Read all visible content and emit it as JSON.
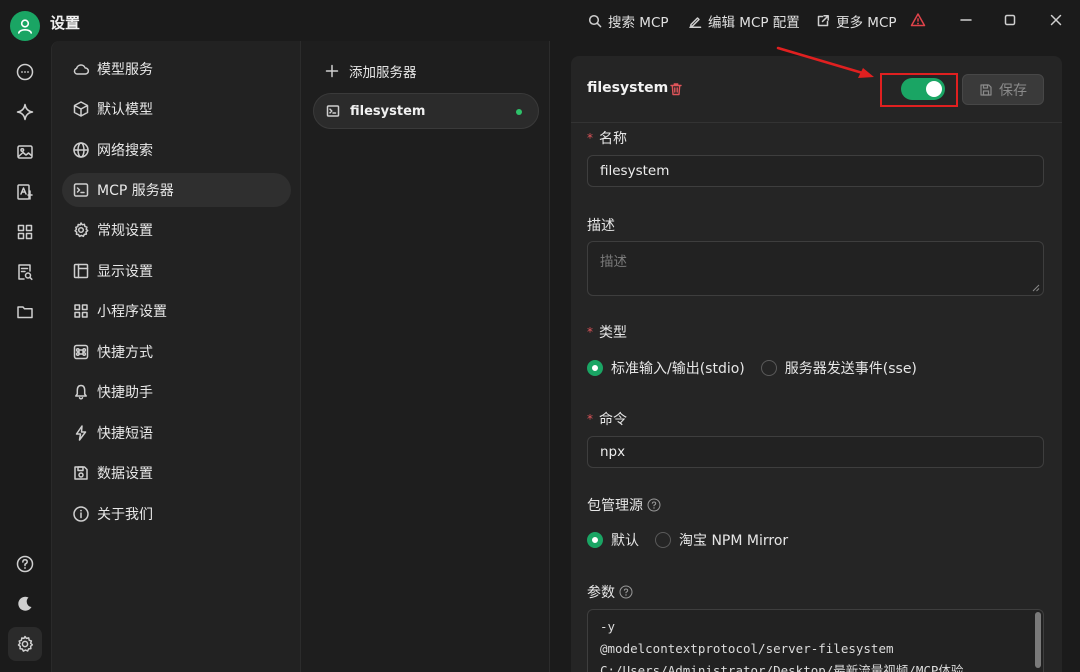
{
  "titlebar": {
    "title": "设置",
    "actions": [
      {
        "label": "搜索 MCP",
        "icon": "search-icon"
      },
      {
        "label": "编辑 MCP 配置",
        "icon": "edit-icon"
      },
      {
        "label": "更多 MCP",
        "icon": "external-link-icon"
      }
    ],
    "warning_icon": "warning-icon",
    "window_controls": [
      "minimize-icon",
      "maximize-icon",
      "close-icon"
    ]
  },
  "rail": {
    "icons": [
      "chat-icon",
      "sparkle-icon",
      "image-icon",
      "translate-icon",
      "apps-icon",
      "doc-search-icon",
      "folder-icon"
    ],
    "bottom_icons": [
      "help-icon",
      "moon-icon",
      "settings-icon"
    ]
  },
  "settings_nav": {
    "items": [
      {
        "label": "模型服务",
        "icon": "cloud-icon"
      },
      {
        "label": "默认模型",
        "icon": "cube-icon"
      },
      {
        "label": "网络搜索",
        "icon": "globe-icon"
      },
      {
        "label": "MCP 服务器",
        "icon": "terminal-icon",
        "active": true
      },
      {
        "label": "常规设置",
        "icon": "gear-icon"
      },
      {
        "label": "显示设置",
        "icon": "layout-icon"
      },
      {
        "label": "小程序设置",
        "icon": "grid-icon"
      },
      {
        "label": "快捷方式",
        "icon": "command-icon"
      },
      {
        "label": "快捷助手",
        "icon": "bell-icon"
      },
      {
        "label": "快捷短语",
        "icon": "bolt-icon"
      },
      {
        "label": "数据设置",
        "icon": "save-icon"
      },
      {
        "label": "关于我们",
        "icon": "info-icon"
      }
    ]
  },
  "server_list": {
    "add_label": "添加服务器",
    "servers": [
      {
        "name": "filesystem",
        "status_color": "#2ec26a"
      }
    ]
  },
  "server_form": {
    "title": "filesystem",
    "enabled": true,
    "save_label": "保存",
    "name_label": "名称",
    "name_value": "filesystem",
    "description_label": "描述",
    "description_placeholder": "描述",
    "type_label": "类型",
    "type_options": [
      "标准输入/输出(stdio)",
      "服务器发送事件(sse)"
    ],
    "type_selected": "标准输入/输出(stdio)",
    "command_label": "命令",
    "command_value": "npx",
    "registry_label": "包管理源",
    "registry_options": [
      "默认",
      "淘宝 NPM Mirror"
    ],
    "registry_selected": "默认",
    "args_label": "参数",
    "args_lines": [
      "-y",
      "@modelcontextprotocol/server-filesystem",
      "C:/Users/Administrator/Desktop/最新流量视频/MCP体验"
    ]
  },
  "colors": {
    "accent": "#1aa564",
    "annotation": "#e02020",
    "required": "#e0555a",
    "warning": "#e0434a"
  }
}
